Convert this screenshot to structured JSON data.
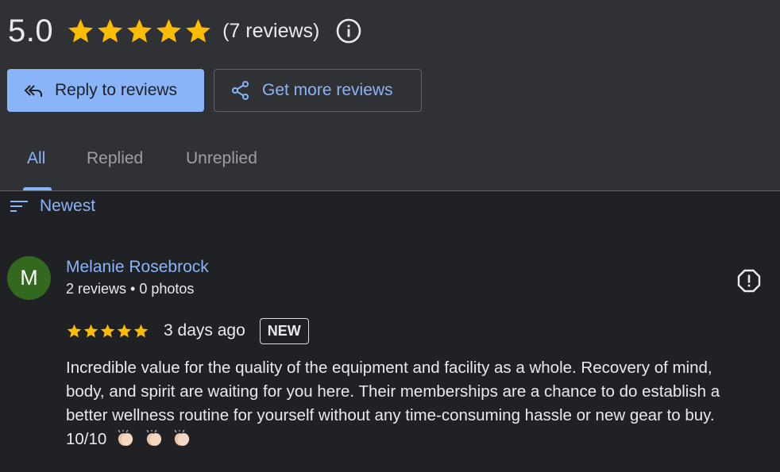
{
  "summary": {
    "score": "5.0",
    "stars": 5,
    "review_count": "(7 reviews)",
    "star_color": "#fbbc04"
  },
  "actions": {
    "reply_label": "Reply to reviews",
    "more_label": "Get more reviews"
  },
  "tabs": [
    {
      "label": "All",
      "active": true
    },
    {
      "label": "Replied",
      "active": false
    },
    {
      "label": "Unreplied",
      "active": false
    }
  ],
  "sort": {
    "label": "Newest"
  },
  "review": {
    "avatar_initial": "M",
    "avatar_color": "#33691e",
    "name": "Melanie Rosebrock",
    "meta": "2 reviews • 0 photos",
    "stars": 5,
    "date": "3 days ago",
    "badge": "NEW",
    "lines": [
      "Incredible value for the quality of the equipment and facility as a whole. Recovery of mind,",
      "body, and spirit are waiting for you here. Their memberships are a chance to do establish a",
      "better wellness routine for yourself without any time-consuming hassle or new gear to buy.",
      "10/10"
    ],
    "emojis": [
      "clapping-hands-icon",
      "clapping-hands-icon",
      "clapping-hands-icon"
    ]
  },
  "colors": {
    "accent": "#8ab4f8",
    "header_bg": "#303134",
    "page_bg": "#202124"
  }
}
